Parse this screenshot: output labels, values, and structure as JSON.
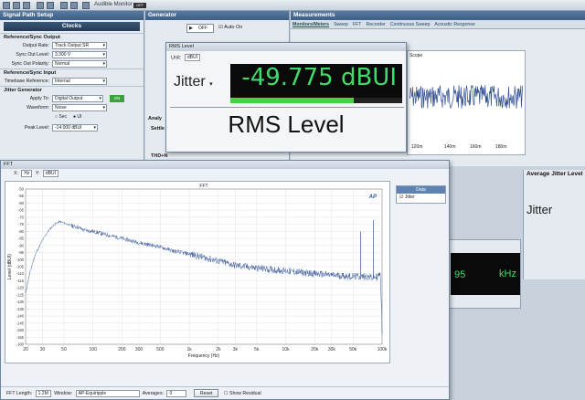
{
  "toolbar": {
    "monitor_label": "Audible Monitor",
    "monitor_state": "OFF"
  },
  "signal_path": {
    "title": "Signal Path Setup",
    "clocks_label": "Clocks",
    "sections": {
      "ref_sync_output": "Reference/Sync Output",
      "ref_sync_input": "Reference/Sync Input",
      "jitter_gen": "Jitter Generator"
    },
    "output_rate": {
      "label": "Output Rate:",
      "value": "Track Output SR"
    },
    "sync_out_level": {
      "label": "Sync Out Level:",
      "value": "3.300 V"
    },
    "sync_out_polarity": {
      "label": "Sync Out Polarity:",
      "value": "Normal"
    },
    "timebase_ref": {
      "label": "Timebase Reference:",
      "value": "Internal"
    },
    "apply_to": {
      "label": "Apply To:",
      "value": "Digital Output",
      "toggle": "ON"
    },
    "waveform": {
      "label": "Waveform:",
      "value": "Noise"
    },
    "sec_ui": {
      "opt1": "Sec",
      "opt2": "UI"
    },
    "peak_level": {
      "label": "Peak Level:",
      "value": "-14.000 dBUI"
    }
  },
  "generator": {
    "title": "Generator",
    "state": "OFF",
    "auto_on": "Auto On",
    "analysis": "Analy",
    "settle": "Settle",
    "thd": "THD+N"
  },
  "measurements": {
    "title": "Measurements",
    "tabs": [
      "Monitors/Meters",
      "Sweep",
      "FFT",
      "Recorder",
      "Continuous Sweep",
      "Acoustic Response"
    ],
    "scope_label": "Scope",
    "scope_ticks": [
      "120m",
      "140m",
      "160m",
      "180m"
    ]
  },
  "rms_window": {
    "title": "RMS Level",
    "unit_label": "Unit:",
    "unit_value": "dBUI",
    "channel": "Jitter",
    "readout": "-49.775 dBUI",
    "bar_fraction": 0.72,
    "caption": "RMS Level"
  },
  "avg_jitter": {
    "title": "Average Jitter Level",
    "channel": "Jitter"
  },
  "freq_meter": {
    "value": "95",
    "unit": "kHz"
  },
  "fft_window": {
    "title": "FFT",
    "x_sel": "Hz",
    "y_sel": "dBUI",
    "x_label": "X:",
    "y_label": "Y:",
    "legend_title": "Data",
    "legend_item": "Jitter",
    "fft_length_label": "FFT Length:",
    "fft_length": "1.2M",
    "window_label": "Window:",
    "window": "AP-Equiripple",
    "averages_label": "Averages:",
    "averages": "0",
    "reset": "Reset",
    "residual": "Show Residual"
  },
  "chart_data": {
    "type": "line",
    "title": "FFT",
    "xlabel": "Frequency (Hz)",
    "ylabel": "Level (dBUI)",
    "x_scale": "log",
    "xlim": [
      20,
      100000
    ],
    "ylim": [
      -160,
      -50
    ],
    "x_ticks": [
      "20",
      "30",
      "50",
      "100",
      "200",
      "300",
      "500",
      "1k",
      "2k",
      "3k",
      "5k",
      "10k",
      "20k",
      "30k",
      "50k",
      "100k"
    ],
    "y_ticks": [
      "-50",
      "-55",
      "-60",
      "-65",
      "-70",
      "-75",
      "-80",
      "-85",
      "-90",
      "-95",
      "-100",
      "-105",
      "-110",
      "-115",
      "-120",
      "-125",
      "-130",
      "-135",
      "-140",
      "-145",
      "-150",
      "-155",
      "-160"
    ],
    "grid": true,
    "series": [
      {
        "name": "Jitter",
        "color": "#3a5a9a",
        "x": [
          20,
          22,
          25,
          30,
          35,
          40,
          45,
          50,
          60,
          70,
          80,
          100,
          150,
          200,
          300,
          500,
          700,
          1000,
          2000,
          3000,
          5000,
          10000,
          20000,
          30000,
          50000,
          70000,
          80000,
          90000,
          95000,
          97000,
          99000,
          100000
        ],
        "y": [
          -124,
          -110,
          -97,
          -86,
          -79,
          -75,
          -73,
          -74,
          -76,
          -77,
          -79,
          -80,
          -83,
          -85,
          -88,
          -91,
          -94,
          -96,
          -101,
          -104,
          -106,
          -108,
          -110,
          -111,
          -112,
          -112,
          -113,
          -112,
          -110,
          -118,
          -135,
          -155
        ]
      }
    ],
    "spikes": [
      {
        "x": 60000,
        "y": -80
      },
      {
        "x": 81000,
        "y": -72
      }
    ]
  }
}
